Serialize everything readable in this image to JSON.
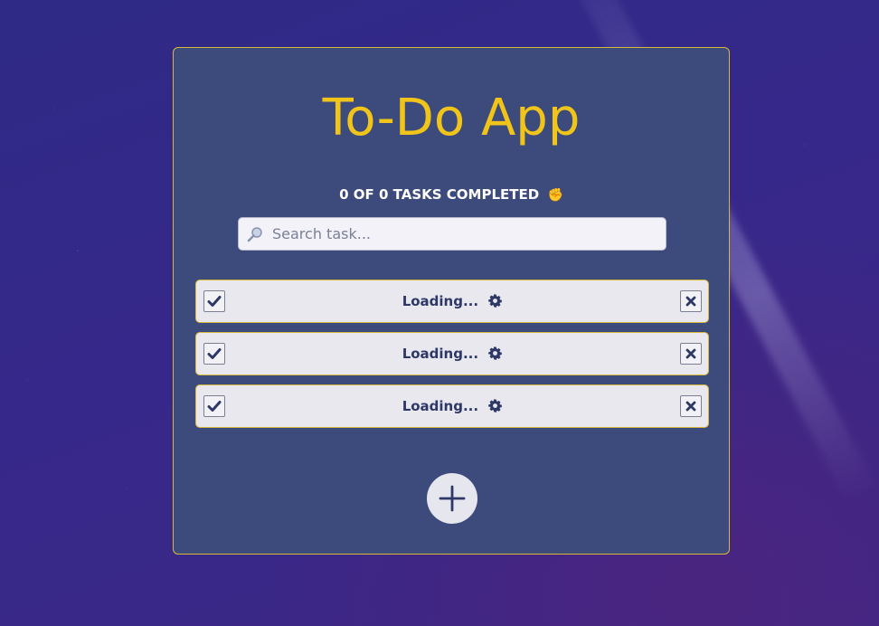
{
  "app": {
    "title": "To-Do App",
    "summary": "0 OF 0 TASKS COMPLETED",
    "summary_emoji": "✊"
  },
  "search": {
    "placeholder": "Search task...",
    "value": ""
  },
  "tasks": [
    {
      "text": "Loading...",
      "status_icon": "gear-icon"
    },
    {
      "text": "Loading...",
      "status_icon": "gear-icon"
    },
    {
      "text": "Loading...",
      "status_icon": "gear-icon"
    }
  ],
  "icons": {
    "search": "magnifier-icon",
    "complete": "check-icon",
    "delete": "close-icon",
    "add": "plus-icon"
  },
  "colors": {
    "accent": "#f0c419",
    "card_background": "#3d4a7c",
    "task_text": "#2e3866",
    "page_background": "#36288a"
  }
}
